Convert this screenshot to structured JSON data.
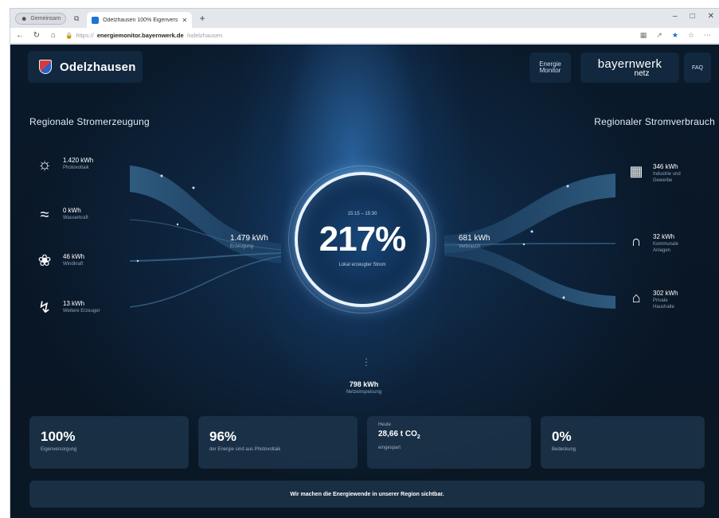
{
  "browser": {
    "profile_label": "Gemeinsam",
    "tab_title": "Odelzhausen 100% Eigenversorg",
    "url_prefix": "https://",
    "url_host": "energiemonitor.bayernwerk.de",
    "url_path": "/odelzhausen"
  },
  "header": {
    "municipality": "Odelzhausen",
    "energie_monitor_line1": "Energie",
    "energie_monitor_line2": "Monitor",
    "bayernwerk_main": "bayernwerk",
    "bayernwerk_sub": "netz",
    "faq": "FAQ"
  },
  "generation": {
    "title": "Regionale Stromerzeugung",
    "sources": [
      {
        "value": "1.420 kWh",
        "label": "Photovoltaik",
        "icon": "sun-icon"
      },
      {
        "value": "0 kWh",
        "label": "Wasserkraft",
        "icon": "water-icon"
      },
      {
        "value": "46 kWh",
        "label": "Windkraft",
        "icon": "wind-turbine-icon"
      },
      {
        "value": "13 kWh",
        "label": "Weitere Erzeuger",
        "icon": "lightning-icon"
      }
    ],
    "total_value": "1.479 kWh",
    "total_label": "Erzeugung"
  },
  "consumption": {
    "title": "Regionaler Stromverbrauch",
    "consumers": [
      {
        "value": "346 kWh",
        "label_line1": "Industrie und",
        "label_line2": "Gewerbe",
        "icon": "factory-icon"
      },
      {
        "value": "32 kWh",
        "label_line1": "Kommunale",
        "label_line2": "Anlagen",
        "icon": "municipal-building-icon"
      },
      {
        "value": "302 kWh",
        "label_line1": "Private",
        "label_line2": "Haushalte",
        "icon": "house-icon"
      }
    ],
    "total_value": "681 kWh",
    "total_label": "Verbrauch"
  },
  "center": {
    "time_range": "15:15 – 15:30",
    "percentage": "217%",
    "subtitle": "Lokal erzeugter Strom"
  },
  "grid_feed": {
    "value": "798 kWh",
    "label": "Netzeinspeisung"
  },
  "cards": {
    "self_supply_value": "100%",
    "self_supply_label": "Eigenversorgung",
    "pv_share_value": "96%",
    "pv_share_label": "der Energie sind aus Photovoltaik",
    "co2_header": "Heute",
    "co2_value": "28,66 t CO",
    "co2_subscript": "2",
    "co2_label": "eingespart",
    "coverage_value": "0%",
    "coverage_label": "Bedeckung"
  },
  "banner": "Wir machen die Energiewende in unserer Region sichtbar.",
  "colors": {
    "background": "#0a1a2b",
    "accent_ring": "#e8f2fb",
    "card": "#1c344a"
  }
}
